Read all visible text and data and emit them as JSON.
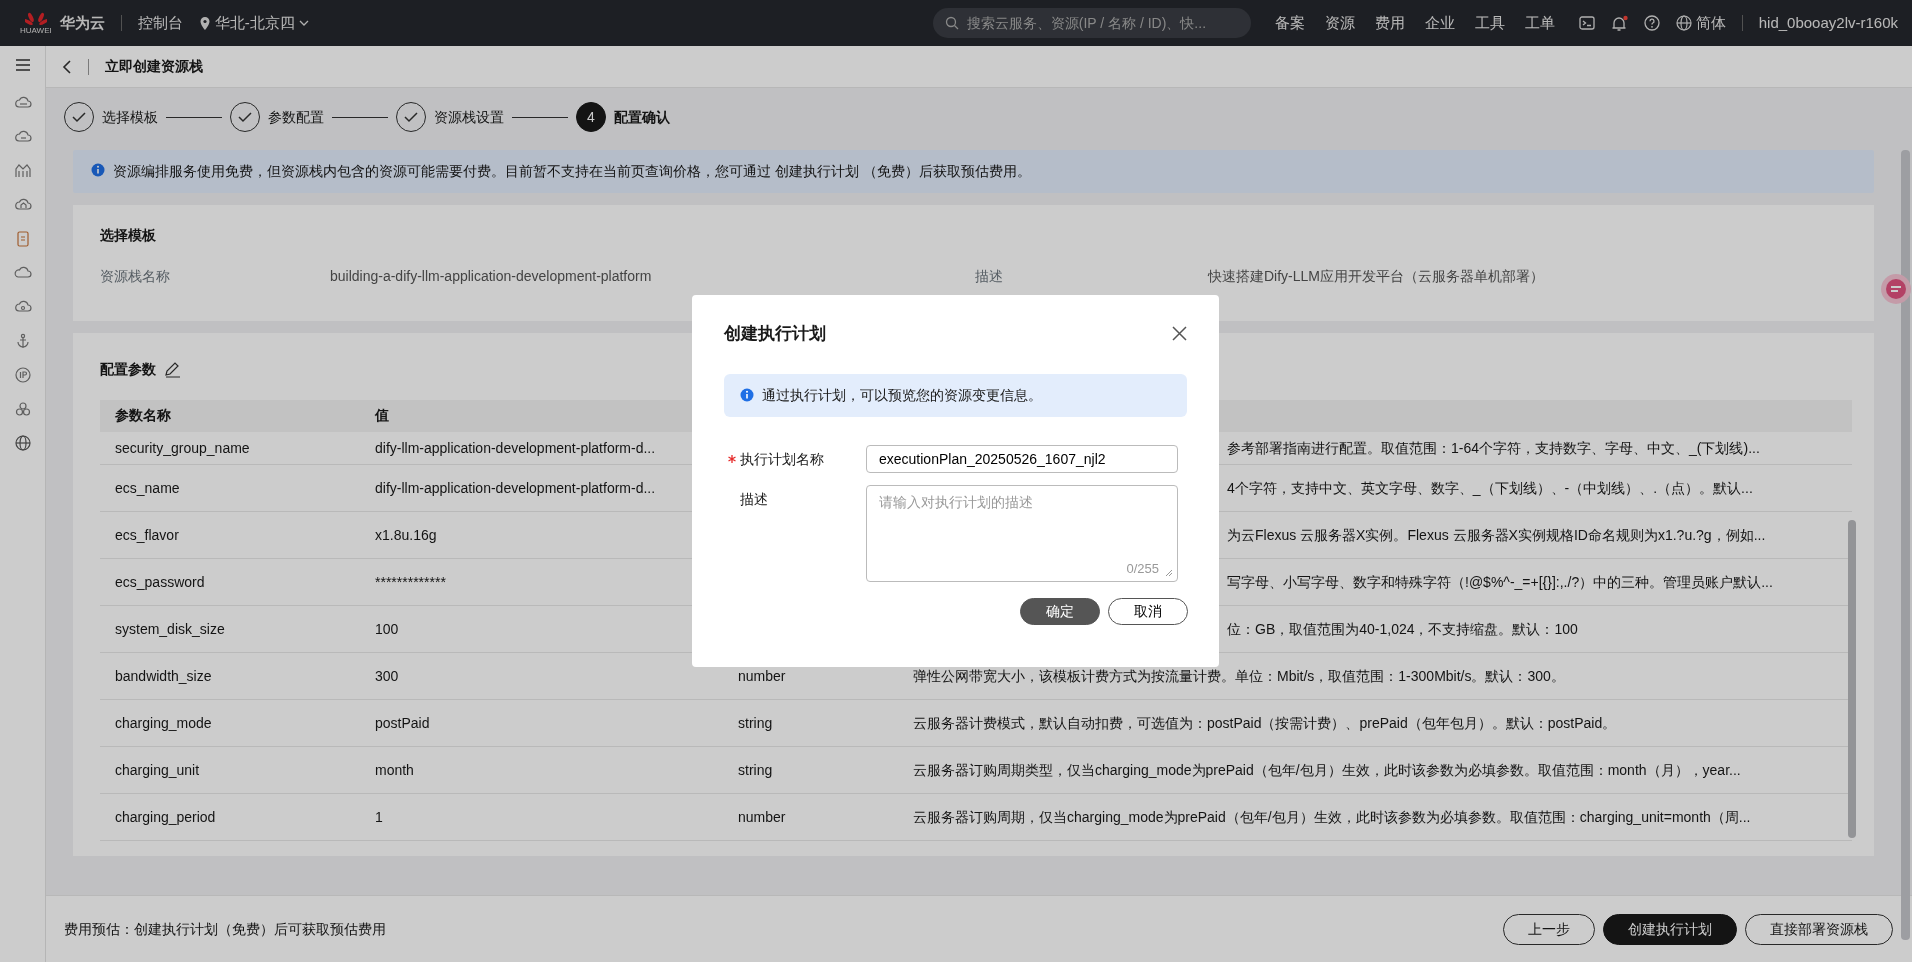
{
  "top_bar": {
    "logo_text": "华为云",
    "logo_caption": "HUAWEI",
    "console": "控制台",
    "region": "华北-北京四",
    "search": {
      "placeholder": "搜索云服务、资源(IP / 名称 / ID)、快..."
    },
    "nav": [
      "备案",
      "资源",
      "费用",
      "企业",
      "工具",
      "工单"
    ],
    "language": "简体",
    "user": "hid_0booay2lv-r160k"
  },
  "page": {
    "title": "立即创建资源栈"
  },
  "steps": [
    {
      "label": "选择模板",
      "completed": true,
      "current": false
    },
    {
      "label": "参数配置",
      "completed": true,
      "current": false
    },
    {
      "label": "资源栈设置",
      "completed": true,
      "current": false
    },
    {
      "label": "配置确认",
      "completed": false,
      "current": true,
      "number": "4"
    }
  ],
  "notice": "资源编排服务使用免费，但资源栈内包含的资源可能需要付费。目前暂不支持在当前页查询价格，您可通过 创建执行计划 （免费）后获取预估费用。",
  "template_card": {
    "title": "选择模板",
    "fields": [
      {
        "label": "资源栈名称",
        "value": "building-a-dify-llm-application-development-platform"
      },
      {
        "label": "描述",
        "value": "快速搭建Dify-LLM应用开发平台（云服务器单机部署）"
      }
    ]
  },
  "params_card": {
    "title": "配置参数",
    "columns": [
      "参数名称",
      "值"
    ],
    "rows": [
      {
        "name": "security_group_name",
        "value": "dify-llm-application-development-platform-d...",
        "description": "参考部署指南进行配置。取值范围：1-64个字符，支持数字、字母、中文、_(下划线)..."
      },
      {
        "name": "ecs_name",
        "value": "dify-llm-application-development-platform-d...",
        "description": "4个字符，支持中文、英文字母、数字、_（下划线）、-（中划线）、.（点）。默认..."
      },
      {
        "name": "ecs_flavor",
        "value": "x1.8u.16g",
        "description": "为云Flexus 云服务器X实例。Flexus 云服务器X实例规格ID命名规则为x1.?u.?g，例如..."
      },
      {
        "name": "ecs_password",
        "value": "*************",
        "description": "写字母、小写字母、数字和特殊字符（!@$%^-_=+[{}]:,./?）中的三种。管理员账户默认..."
      },
      {
        "name": "system_disk_size",
        "value": "100",
        "description": "位：GB，取值范围为40-1,024，不支持缩盘。默认：100"
      },
      {
        "name": "bandwidth_size",
        "value": "300",
        "type": "number",
        "description": "弹性公网带宽大小，该模板计费方式为按流量计费。单位：Mbit/s，取值范围：1-300Mbit/s。默认：300。"
      },
      {
        "name": "charging_mode",
        "value": "postPaid",
        "type": "string",
        "description": "云服务器计费模式，默认自动扣费，可选值为：postPaid（按需计费）、prePaid（包年包月）。默认：postPaid。"
      },
      {
        "name": "charging_unit",
        "value": "month",
        "type": "string",
        "description": "云服务器订购周期类型，仅当charging_mode为prePaid（包年/包月）生效，此时该参数为必填参数。取值范围：month（月），year..."
      },
      {
        "name": "charging_period",
        "value": "1",
        "type": "number",
        "description": "云服务器订购周期，仅当charging_mode为prePaid（包年/包月）生效，此时该参数为必填参数。取值范围：charging_unit=month（周..."
      }
    ]
  },
  "footer": {
    "estimate": "费用预估：创建执行计划（免费）后可获取预估费用",
    "buttons": [
      {
        "label": "上一步",
        "kind": "outline"
      },
      {
        "label": "创建执行计划",
        "kind": "primary"
      },
      {
        "label": "直接部署资源栈",
        "kind": "outline"
      }
    ]
  },
  "dialog": {
    "title": "创建执行计划",
    "notice": "通过执行计划，可以预览您的资源变更信息。",
    "fields": [
      {
        "label": "执行计划名称",
        "required": true,
        "kind": "input",
        "value": "executionPlan_20250526_1607_njl2"
      },
      {
        "label": "描述",
        "required": false,
        "kind": "textarea",
        "placeholder": "请输入对执行计划的描述",
        "counter": "0/255"
      }
    ],
    "buttons": [
      {
        "label": "确定",
        "kind": "primary"
      },
      {
        "label": "取消",
        "kind": "outline"
      }
    ]
  }
}
